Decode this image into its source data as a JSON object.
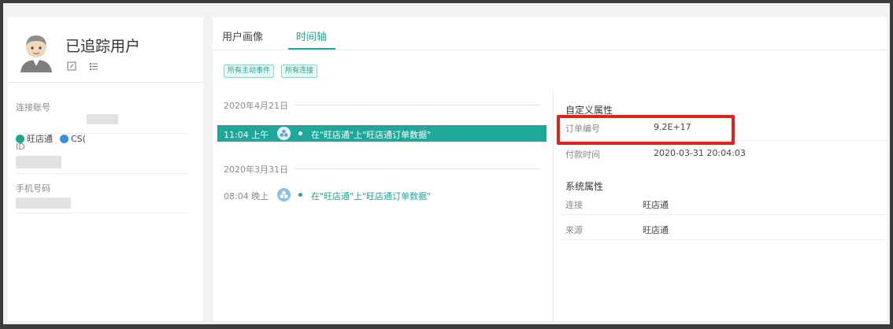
{
  "profile": {
    "title": "已追踪用户",
    "icons": [
      "user-avatar",
      "edit-icon",
      "list-icon"
    ]
  },
  "fields": {
    "account_label": "连接账号",
    "accounts": [
      {
        "name": "旺店通",
        "icon": "wangdiantong-icon",
        "color": "#1aa78a"
      },
      {
        "name": "CS(",
        "icon": "cs-icon",
        "color": "#3a8ee6"
      }
    ],
    "id_label": "ID",
    "phone_label": "手机号码"
  },
  "tabs": [
    {
      "label": "用户画像",
      "active": false
    },
    {
      "label": "时间轴",
      "active": true
    }
  ],
  "filters": [
    "所有主动事件",
    "所有连接"
  ],
  "timeline": [
    {
      "date": "2020年4月21日",
      "time": "11:04 上午",
      "text": "在\"旺店通\"上\"旺店通订单数据\"",
      "selected": true
    },
    {
      "date": "2020年3月31日",
      "time": "08:04 晚上",
      "text": "在\"旺店通\"上\"旺店通订单数据\"",
      "selected": false
    }
  ],
  "custom_props": {
    "title": "自定义属性",
    "rows": [
      {
        "key": "订单编号",
        "value": "9.2E+17"
      },
      {
        "key": "付款时间",
        "value": "2020-03-31 20:04:03"
      }
    ]
  },
  "system_props": {
    "title": "系统属性",
    "rows": [
      {
        "key": "连接",
        "value": "旺店通"
      },
      {
        "key": "来源",
        "value": "旺店通"
      }
    ]
  },
  "colors": {
    "accent": "#17a99a",
    "highlight": "#e2231a"
  }
}
